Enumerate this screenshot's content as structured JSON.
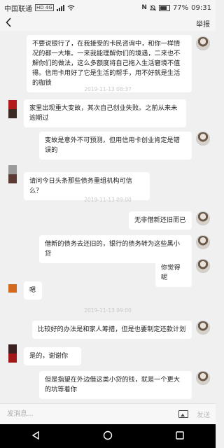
{
  "status_bar": {
    "carrier": "中国联通",
    "network": "HD 4G",
    "battery_text": "77%",
    "time": "09:31"
  },
  "header": {
    "back_icon": "chevron-left-icon",
    "report_label": "举报"
  },
  "messages": [
    {
      "side": "right",
      "text": "不要说银行了，在我接受的卡民咨询中，和你一样情况的都一大堆。一来我能理解你们的境遇，二来也不解你们的做法，这么多额度将自己拖入生活窘境不值得。信用卡用好了它是生活的帮手，用不好就是生活的枷锁"
    },
    {
      "side": "left",
      "text": "家里出现重大变故，其次自己创业失败。之前从来未逾期过"
    },
    {
      "side": "right",
      "text": "变故是意外不可预测，但用信用卡创业肯定是错误的"
    },
    {
      "side": "left",
      "text": "请问今日头条那些债务重组机构可信么？"
    },
    {
      "side": "right",
      "text": "无非借新还旧而已"
    },
    {
      "side": "right",
      "text": "借新的债务去还旧的，银行的债务转为这些黑小贷"
    },
    {
      "side": "right",
      "text": "你觉得呢"
    },
    {
      "side": "left",
      "text": "嗯"
    },
    {
      "side": "right",
      "text": "比较好的办法是和家人筹措，但是也要制定还款计划"
    },
    {
      "side": "left",
      "text": "是的，谢谢你"
    },
    {
      "side": "right",
      "text": "但是指望在外边借这类小贷的钱，就是一个更大的坑等着你"
    }
  ],
  "timestamps": [
    "2019-11-13 08:37",
    "2019-11-13 09:00",
    "2019-11-13 09:00",
    "2019-11-13 09:00"
  ],
  "input": {
    "placeholder": "发消息...",
    "image_icon": "image-icon",
    "send_label": "发送"
  },
  "nav": {
    "back_icon": "triangle-back-icon",
    "home_icon": "circle-home-icon",
    "recent_icon": "square-recent-icon"
  }
}
